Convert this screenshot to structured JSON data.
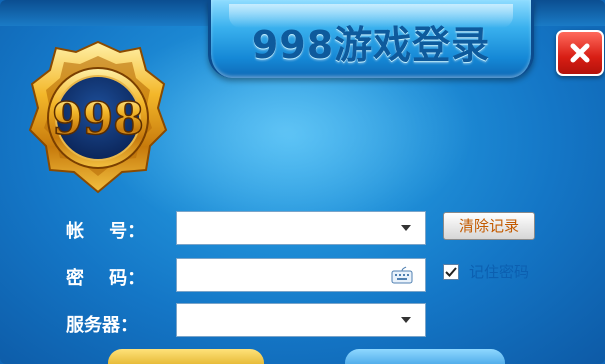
{
  "window": {
    "title": "998游戏登录",
    "logo_text": "998"
  },
  "form": {
    "account": {
      "label": "帐    号：",
      "value": "",
      "control": "dropdown"
    },
    "password": {
      "label": "密    码：",
      "value": "",
      "trailing_icon": "keyboard-icon"
    },
    "server": {
      "label": "服务器：",
      "value": "",
      "control": "dropdown"
    }
  },
  "actions": {
    "clear_records_label": "清除记录",
    "remember_password_label": "记住密码",
    "remember_password_checked": true
  },
  "colors": {
    "background": "#1476c6",
    "title_text": "#0e5a9c",
    "close_button": "#d81e14",
    "clear_button_text": "#c35a00",
    "remember_text": "#0c5fb0",
    "logo_gold": "#e8a21a"
  }
}
